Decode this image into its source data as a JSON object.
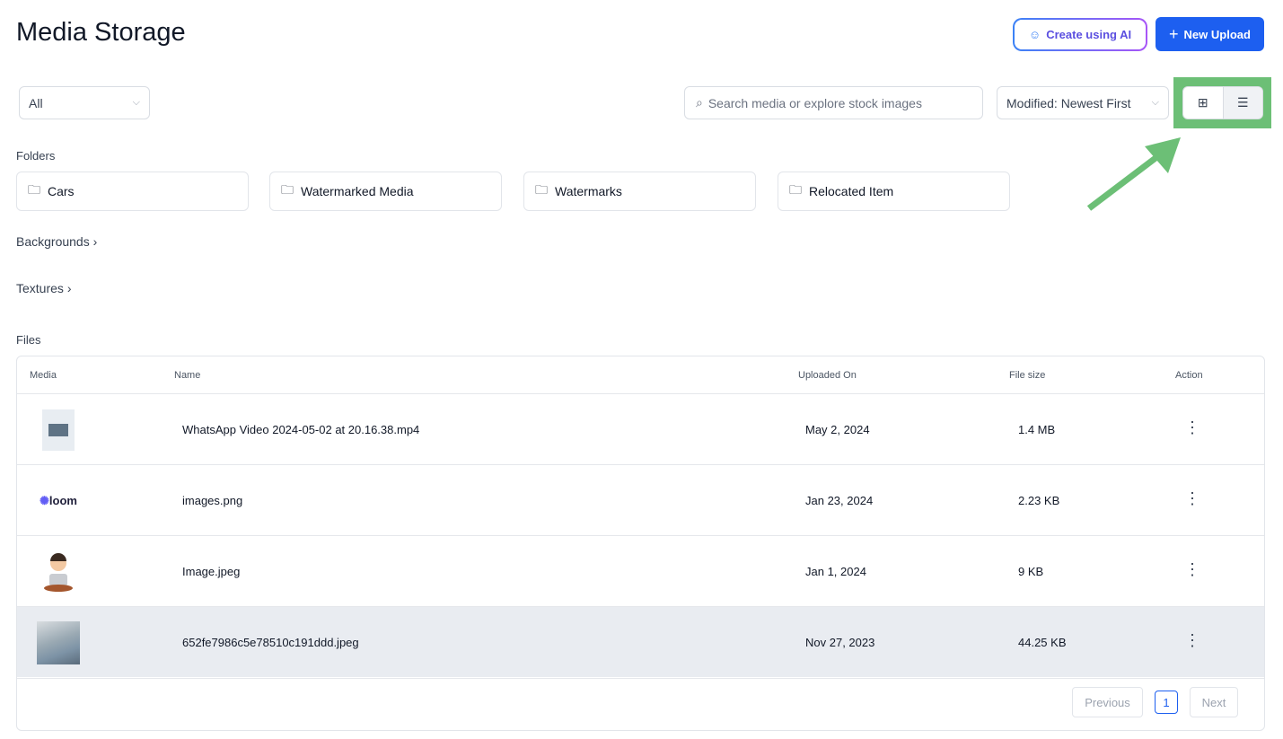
{
  "header": {
    "title": "Media Storage",
    "ai_button": "Create using AI",
    "upload_button": "New Upload",
    "upload_icon": "+"
  },
  "filters": {
    "type_select": "All",
    "search_placeholder": "Search media or explore stock images",
    "sort_select": "Modified: Newest First",
    "view_modes": [
      "grid",
      "list"
    ],
    "active_view": "list"
  },
  "folders": {
    "label": "Folders",
    "items": [
      "Cars",
      "Watermarked Media",
      "Watermarks",
      "Relocated Item"
    ]
  },
  "collections": [
    {
      "label": "Backgrounds"
    },
    {
      "label": "Textures"
    }
  ],
  "files": {
    "label": "Files",
    "columns": [
      "Media",
      "Name",
      "Uploaded On",
      "File size",
      "Action"
    ],
    "rows": [
      {
        "thumb": "video-file-icon",
        "name": "WhatsApp Video 2024-05-02 at 20.16.38.mp4",
        "uploaded": "May 2, 2024",
        "size": "1.4 MB"
      },
      {
        "thumb": "loom-logo",
        "name": "images.png",
        "uploaded": "Jan 23, 2024",
        "size": "2.23 KB"
      },
      {
        "thumb": "avatar-illustration",
        "name": "Image.jpeg",
        "uploaded": "Jan 1, 2024",
        "size": "9 KB"
      },
      {
        "thumb": "room-photo",
        "name": "652fe7986c5e78510c191ddd.jpeg",
        "uploaded": "Nov 27, 2023",
        "size": "44.25 KB",
        "highlighted": true
      }
    ]
  },
  "pagination": {
    "previous": "Previous",
    "current": "1",
    "next": "Next"
  },
  "colors": {
    "primary": "#1d5ff0",
    "annotation": "#6cbf76",
    "row_highlight": "#e9ecf1"
  },
  "logo_text": "loom"
}
